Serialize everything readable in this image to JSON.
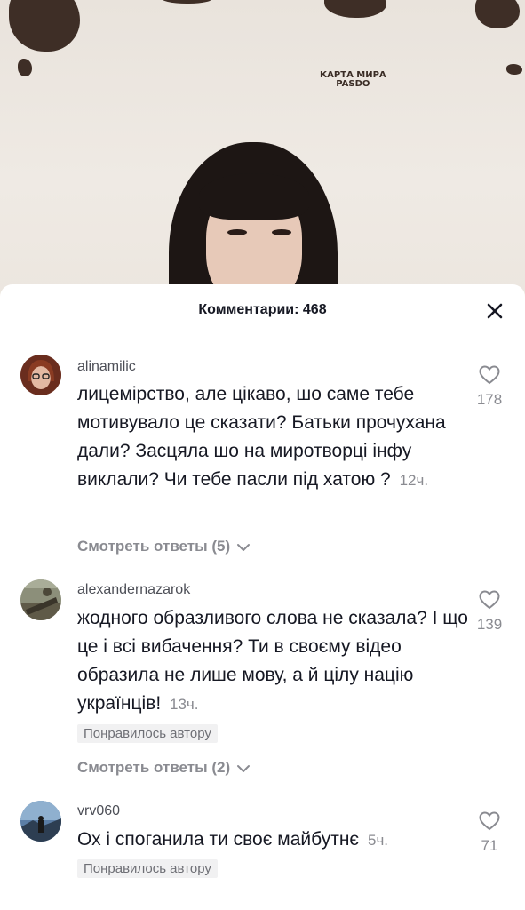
{
  "header": {
    "title": "Комментарии: 468"
  },
  "video": {
    "sign_text_line1": "КАРТА МИРА",
    "sign_text_line2": "PASDO"
  },
  "comments": [
    {
      "username": "alinamilic",
      "text": "лицемірство, але цікаво, шо саме тебе мотивувало це сказати? Батьки прочухана дали? Засцяла шо на миротворці інфу виклали? Чи тебе пасли під хатою ?",
      "time": "12ч.",
      "likes": "178",
      "replies_label": "Смотреть ответы (5)"
    },
    {
      "username": "alexandernazarok",
      "text": "жодного образливого слова не сказала? І що це і всі вибачення? Ти в своєму відео образила не лише мову, а й цілу націю українців!",
      "time": "13ч.",
      "likes": "139",
      "badge": "Понравилось автору",
      "replies_label": "Смотреть ответы (2)"
    },
    {
      "username": "vrv060",
      "text": "Ох і споганила ти своє майбутнє",
      "time": "5ч.",
      "likes": "71",
      "badge": "Понравилось автору"
    }
  ],
  "icons": {
    "close": "close-icon",
    "like": "heart-outline-icon",
    "expand": "chevron-down-icon"
  },
  "colors": {
    "text_primary": "#161823",
    "text_secondary": "#8a8b91",
    "badge_bg": "#f1f1f2"
  }
}
